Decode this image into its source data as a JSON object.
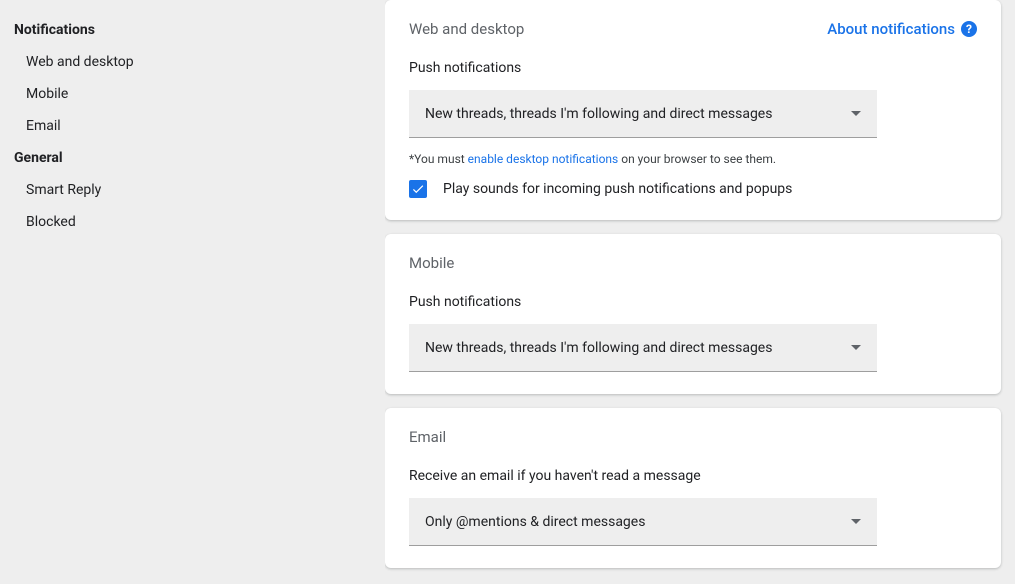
{
  "sidebar": {
    "groups": [
      {
        "header": "Notifications",
        "items": [
          "Web and desktop",
          "Mobile",
          "Email"
        ]
      },
      {
        "header": "General",
        "items": [
          "Smart Reply",
          "Blocked"
        ]
      }
    ]
  },
  "about_link": "About notifications",
  "cards": {
    "web": {
      "title": "Web and desktop",
      "field_label": "Push notifications",
      "select_value": "New threads, threads I'm following and direct messages",
      "hint_prefix": "*You must ",
      "hint_link": "enable desktop notifications",
      "hint_suffix": " on your browser to see them.",
      "checkbox_label": "Play sounds for incoming push notifications and popups"
    },
    "mobile": {
      "title": "Mobile",
      "field_label": "Push notifications",
      "select_value": "New threads, threads I'm following and direct messages"
    },
    "email": {
      "title": "Email",
      "field_label": "Receive an email if you haven't read a message",
      "select_value": "Only @mentions & direct messages"
    }
  }
}
